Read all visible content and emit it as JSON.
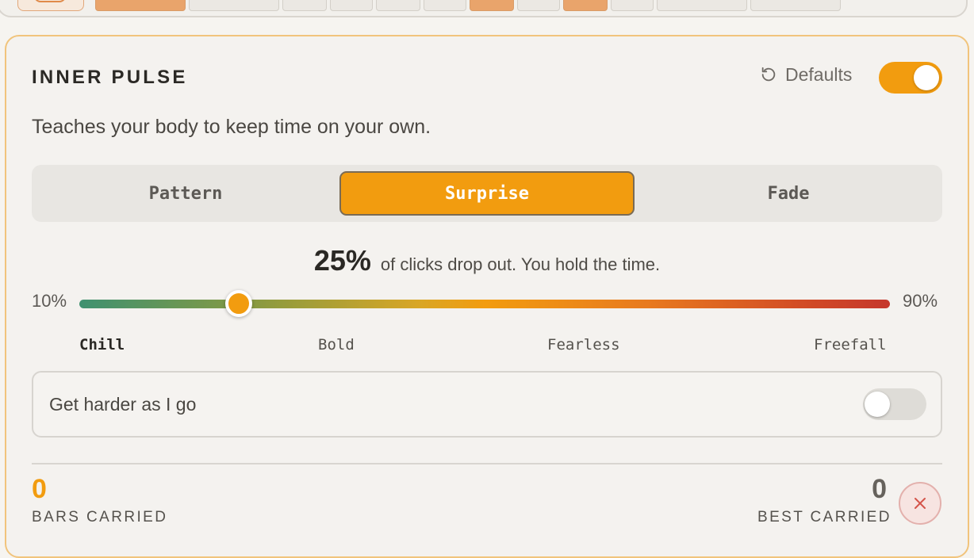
{
  "card": {
    "title": "INNER PULSE",
    "defaults_label": "Defaults",
    "subtitle": "Teaches your body to keep time on your own.",
    "enabled": true
  },
  "modes": {
    "items": [
      "Pattern",
      "Surprise",
      "Fade"
    ],
    "selected": "Surprise"
  },
  "dropout": {
    "value": "25%",
    "description": "of clicks drop out. You hold the time.",
    "min_label": "10%",
    "max_label": "90%",
    "slider_value_percent": 25,
    "levels": [
      "Chill",
      "Bold",
      "Fearless",
      "Freefall"
    ],
    "selected_level": "Chill"
  },
  "harder": {
    "label": "Get harder as I go",
    "enabled": false
  },
  "stats": {
    "bars_carried_value": "0",
    "bars_carried_label": "BARS CARRIED",
    "best_carried_value": "0",
    "best_carried_label": "BEST CARRIED"
  },
  "colors": {
    "accent": "#f29c0f",
    "card_border": "#f1c47c",
    "close_icon": "#d4544a"
  }
}
